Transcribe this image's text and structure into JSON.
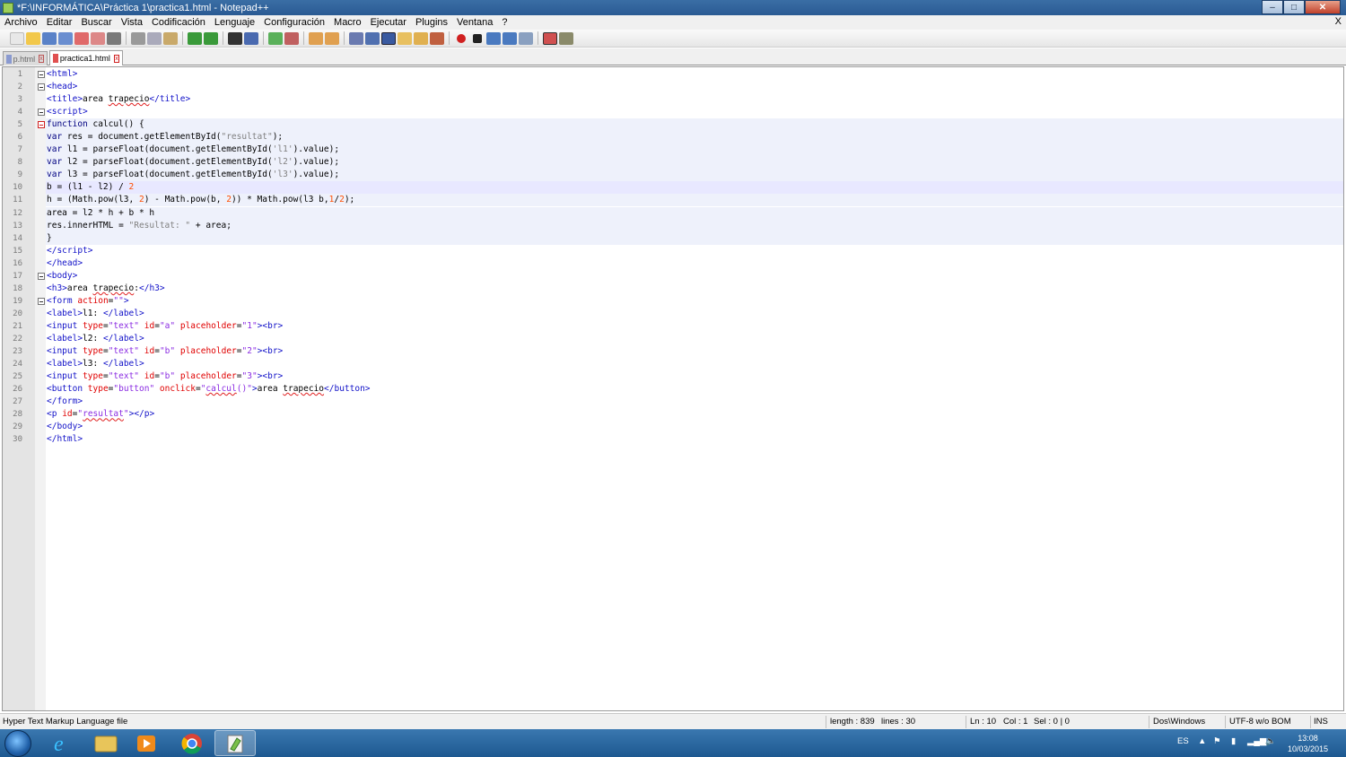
{
  "window": {
    "title": "*F:\\INFORMÁTICA\\Práctica 1\\practica1.html - Notepad++"
  },
  "menu": {
    "items": [
      "Archivo",
      "Editar",
      "Buscar",
      "Vista",
      "Codificación",
      "Lenguaje",
      "Configuración",
      "Macro",
      "Ejecutar",
      "Plugins",
      "Ventana",
      "?"
    ],
    "close_doc": "X"
  },
  "tabs": [
    {
      "label": "p.html",
      "active": false
    },
    {
      "label": "practica1.html",
      "active": true
    }
  ],
  "editor": {
    "line_numbers": [
      "1",
      "2",
      "3",
      "4",
      "5",
      "6",
      "7",
      "8",
      "9",
      "10",
      "11",
      "12",
      "13",
      "14",
      "15",
      "16",
      "17",
      "18",
      "19",
      "20",
      "21",
      "22",
      "23",
      "24",
      "25",
      "26",
      "27",
      "28",
      "29",
      "30"
    ],
    "current_line": 10
  },
  "status": {
    "file_type": "Hyper Text Markup Language file",
    "length": "length : 839",
    "lines": "lines : 30",
    "ln": "Ln : 10",
    "col": "Col : 1",
    "sel": "Sel : 0 | 0",
    "eol": "Dos\\Windows",
    "encoding": "UTF-8 w/o BOM",
    "mode": "INS"
  },
  "taskbar": {
    "lang": "ES",
    "time": "13:08",
    "date": "10/03/2015"
  },
  "colors": {
    "tag": "#1010c8",
    "attr": "#e00000",
    "string": "#8a2be2",
    "js_string": "#808080",
    "number": "#ff4d00"
  }
}
